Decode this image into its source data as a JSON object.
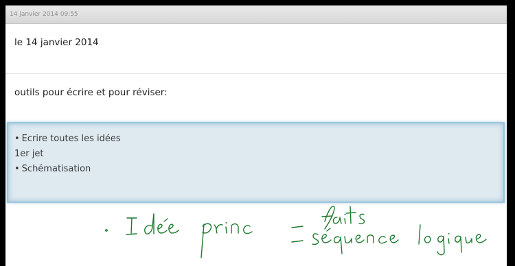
{
  "note": {
    "timestamp": "14 janvier 2014 09:55",
    "date_line": "le 14 janvier 2014",
    "tools_line": "outils pour écrire et pour réviser:",
    "selected_lines": [
      {
        "bullet": "•",
        "text": "Ecrire toutes les idées"
      },
      {
        "bullet": "",
        "text": "1er jet"
      },
      {
        "bullet": "•",
        "text": "Schématisation"
      }
    ],
    "handwriting": {
      "color": "#1c7a2c",
      "text": "· Idée princ – faits – séquence logique"
    }
  }
}
